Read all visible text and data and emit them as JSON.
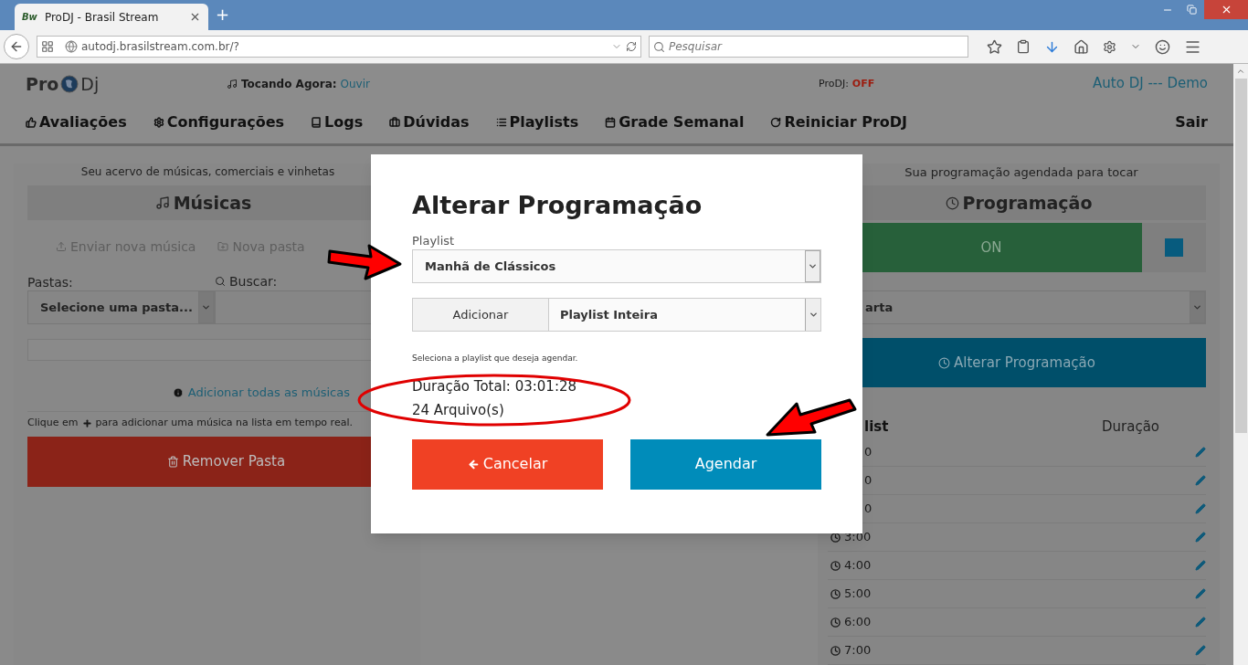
{
  "browser": {
    "tab_title": "ProDJ - Brasil Stream",
    "favicon": "Bw",
    "new_tab": "+",
    "url": "autodj.brasilstream.com.br/?",
    "search_placeholder": "Pesquisar"
  },
  "header": {
    "logo_left": "Pro",
    "logo_right": "Dj",
    "now_playing_label": "Tocando Agora:",
    "now_playing_link": "Ouvir",
    "status_label": "ProDJ:",
    "status_value": "OFF",
    "account": "Auto DJ --- Demo"
  },
  "nav": [
    {
      "label": "Avaliações",
      "kind": "thumb"
    },
    {
      "label": "Configurações",
      "kind": "gear"
    },
    {
      "label": "Logs",
      "kind": "book"
    },
    {
      "label": "Dúvidas",
      "kind": "case"
    },
    {
      "label": "Playlists",
      "kind": "list"
    },
    {
      "label": "Grade Semanal",
      "kind": "calendar"
    },
    {
      "label": "Reiniciar ProDJ",
      "kind": "refresh"
    }
  ],
  "logout": "Sair",
  "library": {
    "caption": "Seu acervo de músicas, comerciais e vinhetas",
    "title": "Músicas",
    "upload": "Enviar nova música",
    "new_folder": "Nova pasta",
    "folders_label": "Pastas:",
    "folder_value": "Selecione uma pasta...",
    "search_label": "Buscar:",
    "add_all": "Adicionar todas as músicas",
    "hint_before": "Clique em",
    "hint_after": "para adicionar uma música na lista em tempo real.",
    "remove": "Remover Pasta"
  },
  "schedule": {
    "caption": "Sua programação agendada para tocar",
    "title": "Programação",
    "toggle": {
      "label": "ON",
      "on": true
    },
    "day_value": "arta",
    "change_button": "Alterar Programação",
    "columns": [
      "list",
      "Duração"
    ],
    "rows": [
      {
        "time": "0",
        "clock": false
      },
      {
        "time": "0",
        "clock": false
      },
      {
        "time": "0",
        "clock": false
      },
      {
        "time": "3:00",
        "clock": true
      },
      {
        "time": "4:00",
        "clock": true
      },
      {
        "time": "5:00",
        "clock": true
      },
      {
        "time": "6:00",
        "clock": true
      },
      {
        "time": "7:00",
        "clock": true
      }
    ]
  },
  "modal": {
    "title": "Alterar Programação",
    "playlist_label": "Playlist",
    "playlist_value": "Manhã de Clássicos",
    "addon": "Adicionar",
    "add_value": "Playlist Inteira",
    "help": "Seleciona a playlist que deseja agendar.",
    "duration": "Duração Total: 03:01:28",
    "files": "24 Arquivo(s)",
    "cancel": "Cancelar",
    "submit": "Agendar"
  }
}
